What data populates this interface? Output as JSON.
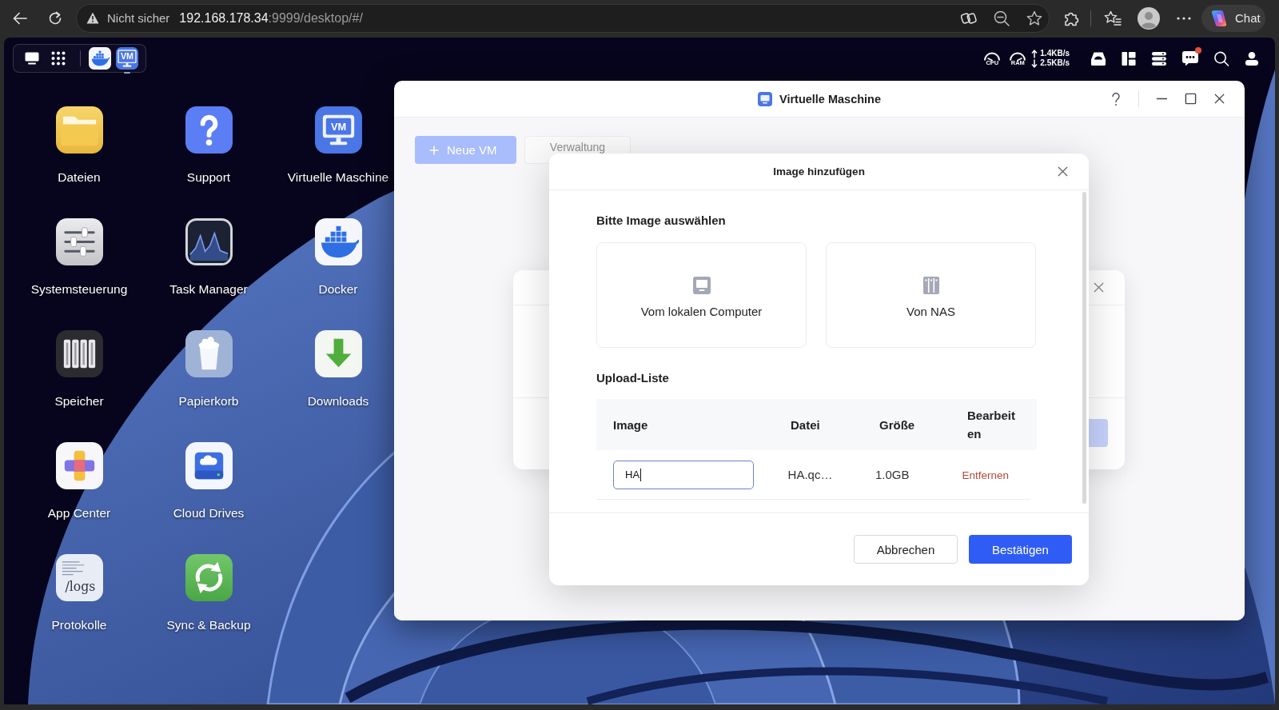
{
  "browser": {
    "security_label": "Nicht sicher",
    "url_host": "192.168.178.34",
    "url_path": ":9999/desktop/#/",
    "chat_label": "Chat"
  },
  "taskbar": {
    "pinned": [
      {
        "kind": "docker",
        "running": false
      },
      {
        "kind": "vm",
        "running": true,
        "logo_text": "VM"
      }
    ],
    "cpu_label": "CPU",
    "ram_label": "RAM",
    "upload": "1.4KB/s",
    "download": "2.5KB/s",
    "notifications_unread": true
  },
  "desktop": {
    "apps": [
      {
        "label": "Dateien",
        "kind": "files"
      },
      {
        "label": "Systemsteuerung",
        "kind": "settings"
      },
      {
        "label": "Speicher",
        "kind": "storage"
      },
      {
        "label": "App Center",
        "kind": "appcenter"
      },
      {
        "label": "Protokolle",
        "kind": "logs",
        "logo_text": "/logs"
      },
      {
        "label": "Support",
        "kind": "support"
      },
      {
        "label": "Task Manager",
        "kind": "taskmanager"
      },
      {
        "label": "Papierkorb",
        "kind": "trash"
      },
      {
        "label": "Cloud Drives",
        "kind": "clouddrives"
      },
      {
        "label": "Sync & Backup",
        "kind": "sync"
      },
      {
        "label": "Virtuelle Maschine",
        "kind": "vm",
        "logo_text": "VM"
      },
      {
        "label": "Docker",
        "kind": "docker"
      },
      {
        "label": "Downloads",
        "kind": "downloads"
      }
    ]
  },
  "window": {
    "title": "Virtuelle Maschine",
    "toolbar": [
      {
        "label": "Neue VM",
        "kind": "primary"
      },
      {
        "label": "Verwaltung",
        "kind": "tab"
      }
    ]
  },
  "dialog": {
    "title": "Image hinzufügen",
    "source_heading": "Bitte Image auswählen",
    "sources": [
      {
        "label": "Vom lokalen Computer",
        "kind": "local"
      },
      {
        "label": "Von NAS",
        "kind": "nas"
      }
    ],
    "upload_heading": "Upload-Liste",
    "table": {
      "columns": [
        "Image",
        "Datei",
        "Größe",
        "Bearbeiten"
      ],
      "rows": [
        {
          "image": "HA",
          "focused": true,
          "file": "HA.qc…",
          "size": "1.0GB",
          "action": "Entfernen"
        }
      ]
    },
    "buttons": [
      {
        "label": "Abbrechen",
        "kind": "secondary"
      },
      {
        "label": "Bestätigen",
        "kind": "primary"
      }
    ]
  }
}
